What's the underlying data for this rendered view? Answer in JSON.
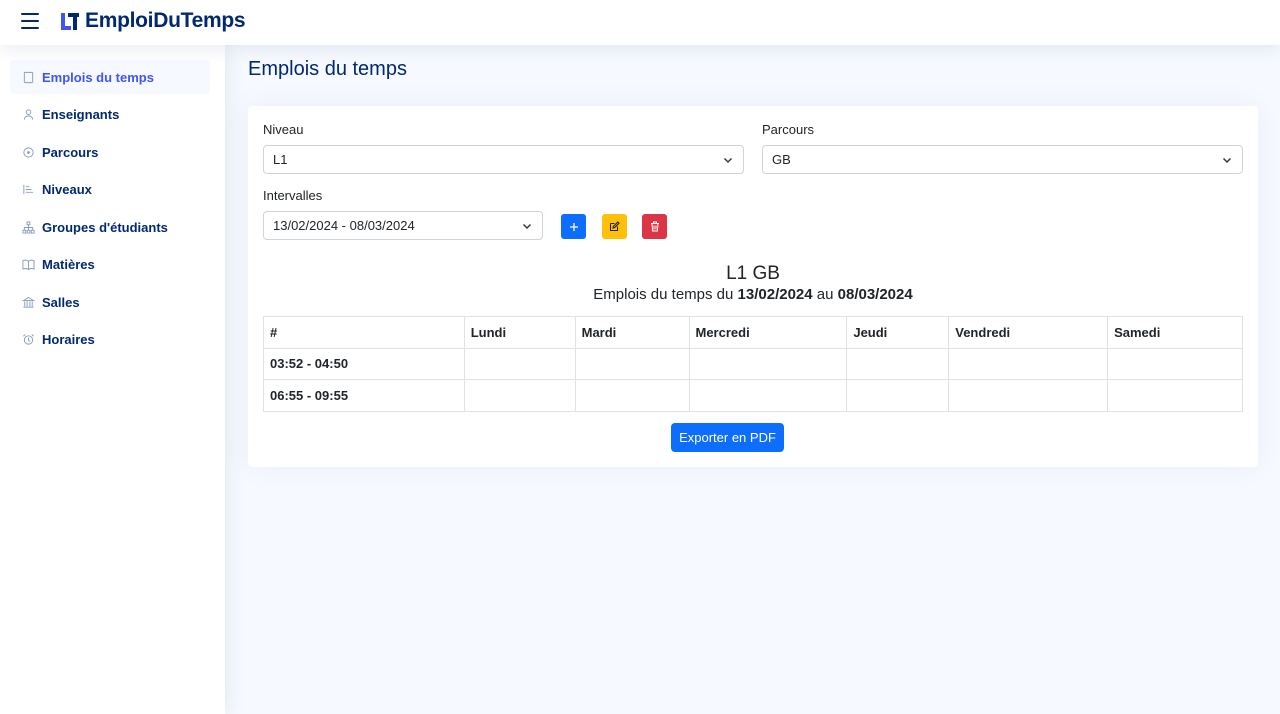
{
  "header": {
    "brand": "EmploiDuTemps",
    "menu_icon": "hamburger-icon",
    "colors": {
      "brand": "#012970",
      "accent": "#4154f1"
    }
  },
  "sidebar": {
    "items": [
      {
        "label": "Emplois du temps",
        "icon": "calendar-icon",
        "active": true
      },
      {
        "label": "Enseignants",
        "icon": "person-icon"
      },
      {
        "label": "Parcours",
        "icon": "compass-icon"
      },
      {
        "label": "Niveaux",
        "icon": "levels-icon"
      },
      {
        "label": "Groupes d'étudiants",
        "icon": "diagram-icon"
      },
      {
        "label": "Matières",
        "icon": "book-icon"
      },
      {
        "label": "Salles",
        "icon": "bank-icon"
      },
      {
        "label": "Horaires",
        "icon": "alarm-icon"
      }
    ]
  },
  "main": {
    "page_title": "Emplois du temps",
    "form": {
      "niveau_label": "Niveau",
      "niveau_value": "L1",
      "parcours_label": "Parcours",
      "parcours_value": "GB",
      "intervalles_label": "Intervalles",
      "intervalles_value": "13/02/2024 - 08/03/2024"
    },
    "actions": {
      "add_icon": "plus-icon",
      "edit_icon": "edit-icon",
      "delete_icon": "trash-icon",
      "colors": {
        "add": "#0d6efd",
        "edit": "#ffc107",
        "delete": "#dc3545"
      }
    },
    "timetable": {
      "title": "L1 GB",
      "subtitle_prefix": "Emplois du temps du",
      "date_from": "13/02/2024",
      "subtitle_middle": "au",
      "date_to": "08/03/2024",
      "headers": [
        "#",
        "Lundi",
        "Mardi",
        "Mercredi",
        "Jeudi",
        "Vendredi",
        "Samedi"
      ],
      "rows": [
        [
          "03:52 - 04:50",
          "",
          "",
          "",
          "",
          "",
          ""
        ],
        [
          "06:55 - 09:55",
          "",
          "",
          "",
          "",
          "",
          ""
        ]
      ]
    },
    "export_label": "Exporter en PDF"
  }
}
